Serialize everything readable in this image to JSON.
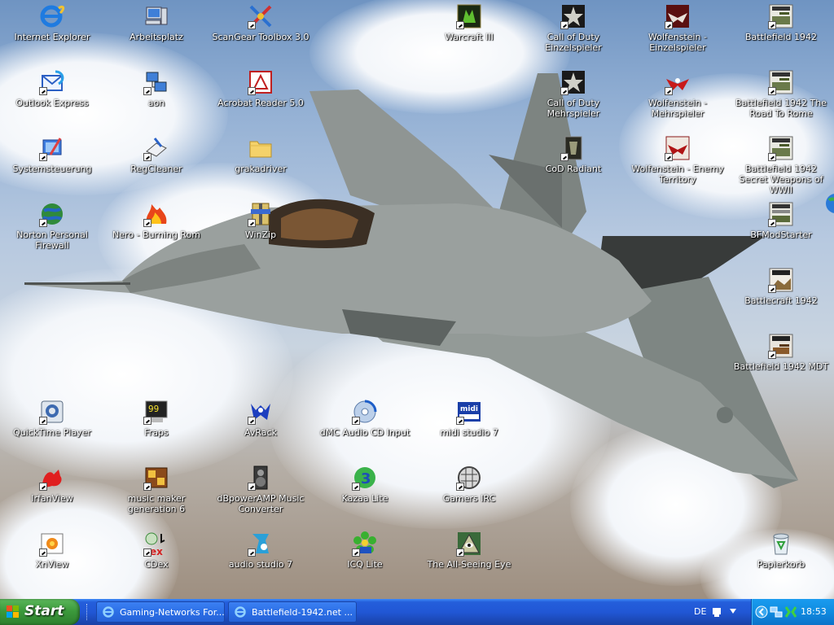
{
  "desktop": {
    "icons": [
      {
        "label": "Internet Explorer",
        "icon": "internet-explorer-icon",
        "shortcut": false
      },
      {
        "label": "Arbeitsplatz",
        "icon": "my-computer-icon",
        "shortcut": false
      },
      {
        "label": "ScanGear Toolbox 3.0",
        "icon": "scangear-toolbox-icon",
        "shortcut": true
      },
      {
        "label": "Warcraft III",
        "icon": "warcraft-3-icon",
        "shortcut": true
      },
      {
        "label": "Call of Duty Einzelspieler",
        "icon": "call-of-duty-star-icon",
        "shortcut": true
      },
      {
        "label": "Wolfenstein - Einzelspieler",
        "icon": "wolfenstein-eagle-icon",
        "shortcut": true
      },
      {
        "label": "Battlefield 1942",
        "icon": "battlefield-1942-icon",
        "shortcut": true
      },
      {
        "label": "Outlook Express",
        "icon": "outlook-express-icon",
        "shortcut": true
      },
      {
        "label": "aon",
        "icon": "network-connection-icon",
        "shortcut": true
      },
      {
        "label": "Acrobat Reader 5.0",
        "icon": "acrobat-reader-icon",
        "shortcut": true
      },
      {
        "label": "Call of Duty Mehrspieler",
        "icon": "call-of-duty-star-icon",
        "shortcut": true
      },
      {
        "label": "Wolfenstein - Mehrspieler",
        "icon": "wolfenstein-eagle-icon",
        "shortcut": true
      },
      {
        "label": "Battlefield 1942 The Road To Rome",
        "icon": "battlefield-1942-icon",
        "shortcut": true
      },
      {
        "label": "Systemsteuerung",
        "icon": "control-panel-icon",
        "shortcut": true
      },
      {
        "label": "RegCleaner",
        "icon": "regcleaner-icon",
        "shortcut": true
      },
      {
        "label": "grakadriver",
        "icon": "folder-icon",
        "shortcut": false
      },
      {
        "label": "CoD Radiant",
        "icon": "cod-radiant-icon",
        "shortcut": true
      },
      {
        "label": "Wolfenstein - Enemy Territory",
        "icon": "wolfenstein-eagle-icon",
        "shortcut": true
      },
      {
        "label": "Battlefield 1942 Secret Weapons of WWII",
        "icon": "battlefield-1942-icon",
        "shortcut": true
      },
      {
        "label": "Norton Personal Firewall",
        "icon": "norton-firewall-globe-icon",
        "shortcut": true
      },
      {
        "label": "Nero - Burning Rom",
        "icon": "nero-flame-icon",
        "shortcut": true
      },
      {
        "label": "WinZip",
        "icon": "winzip-icon",
        "shortcut": true
      },
      {
        "label": "BFModStarter",
        "icon": "battlefield-modstarter-icon",
        "shortcut": true
      },
      {
        "label": "Battlecraft 1942",
        "icon": "battlecraft-1942-icon",
        "shortcut": true
      },
      {
        "label": "Battlefield 1942 MDT",
        "icon": "battlefield-mdt-icon",
        "shortcut": true
      },
      {
        "label": "QuickTime Player",
        "icon": "quicktime-icon",
        "shortcut": true
      },
      {
        "label": "Fraps",
        "icon": "fraps-icon",
        "shortcut": true
      },
      {
        "label": "AvRack",
        "icon": "avrack-icon",
        "shortcut": true
      },
      {
        "label": "dMC Audio CD Input",
        "icon": "audio-cd-icon",
        "shortcut": true
      },
      {
        "label": "midi studio 7",
        "icon": "midi-studio-icon",
        "shortcut": true
      },
      {
        "label": "IrfanView",
        "icon": "irfanview-cat-icon",
        "shortcut": true
      },
      {
        "label": "music maker generation 6",
        "icon": "music-maker-icon",
        "shortcut": true
      },
      {
        "label": "dBpowerAMP Music Converter",
        "icon": "dbpoweramp-speaker-icon",
        "shortcut": true
      },
      {
        "label": "Kazaa Lite",
        "icon": "kazaa-lite-icon",
        "shortcut": true
      },
      {
        "label": "Gamers IRC",
        "icon": "gamers-irc-icon",
        "shortcut": true
      },
      {
        "label": "XnView",
        "icon": "xnview-icon",
        "shortcut": true
      },
      {
        "label": "CDex",
        "icon": "cdex-icon",
        "shortcut": true
      },
      {
        "label": "audio studio 7",
        "icon": "audio-studio-icon",
        "shortcut": true
      },
      {
        "label": "ICQ Lite",
        "icon": "icq-flower-icon",
        "shortcut": true
      },
      {
        "label": "The All-Seeing Eye",
        "icon": "all-seeing-eye-icon",
        "shortcut": true
      },
      {
        "label": "Papierkorb",
        "icon": "recycle-bin-icon",
        "shortcut": false
      }
    ]
  },
  "taskbar": {
    "start_label": "Start",
    "tasks": [
      {
        "label": "Gaming-Networks For...",
        "icon": "internet-explorer-icon"
      },
      {
        "label": "Battlefield-1942.net ...",
        "icon": "internet-explorer-icon"
      }
    ],
    "language": "DE",
    "clock": "18:53"
  },
  "colors": {
    "taskbar_blue": "#245edb",
    "start_green": "#3c9a3c",
    "tray_blue": "#0f8be0"
  }
}
